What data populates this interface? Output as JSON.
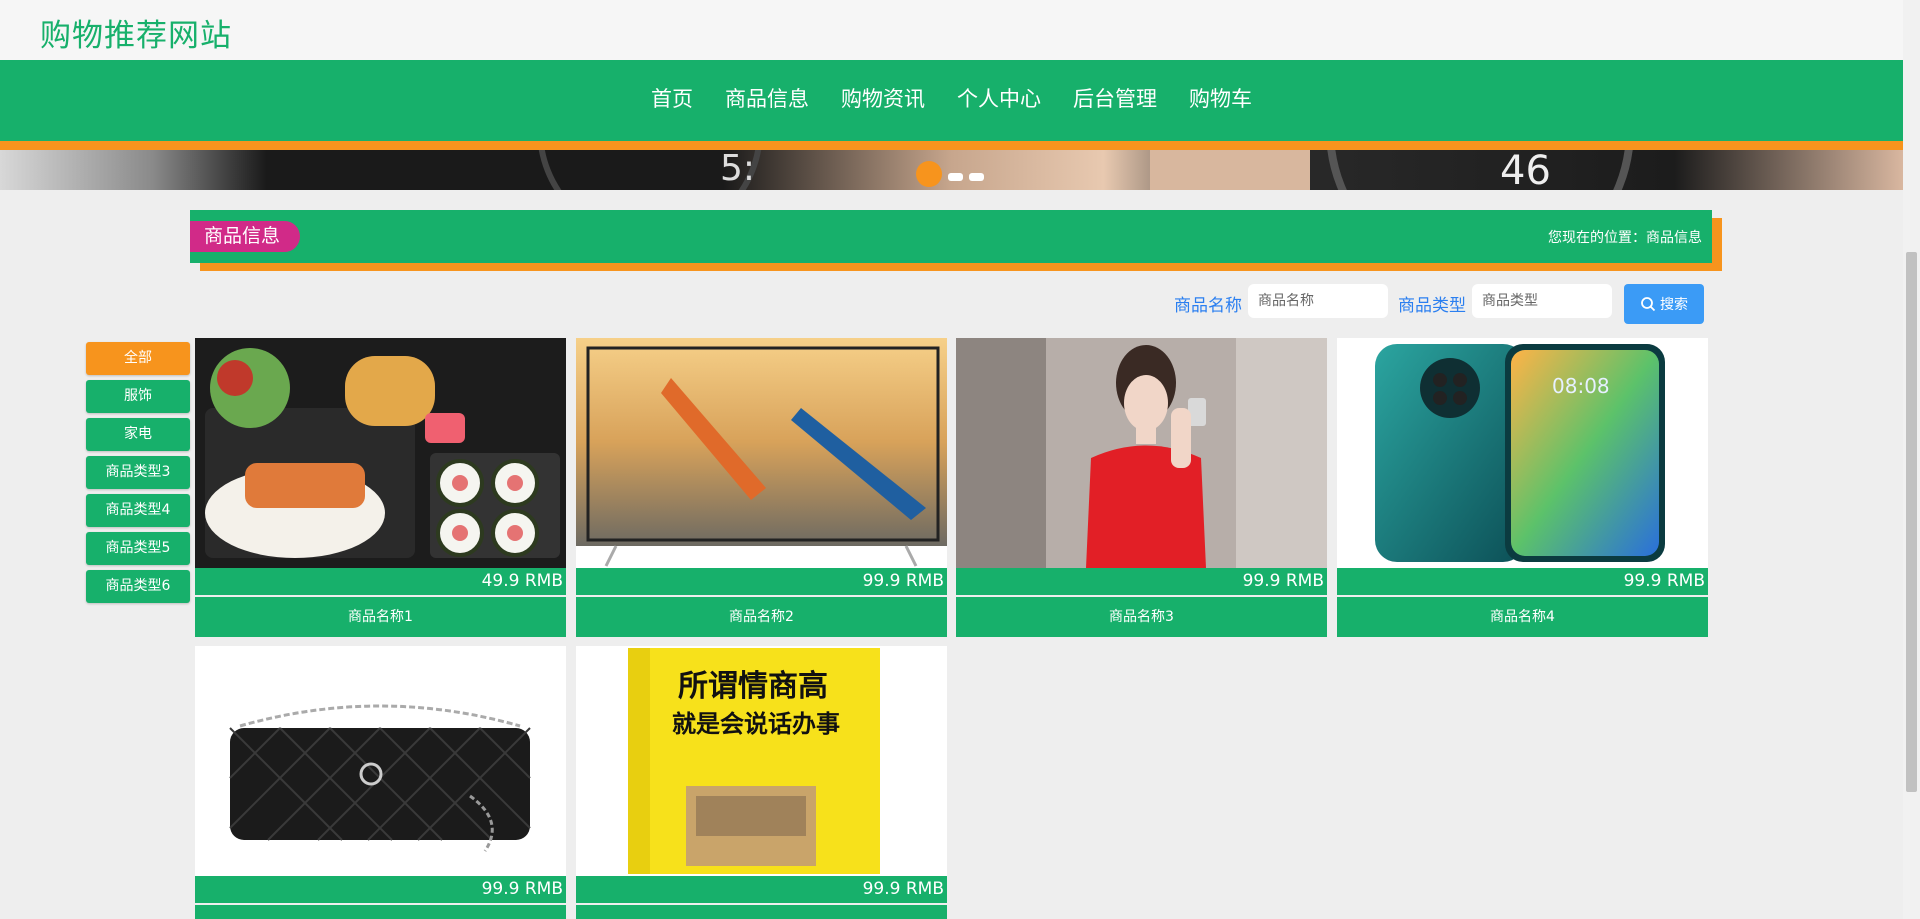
{
  "site": {
    "title": "购物推荐网站"
  },
  "nav": {
    "items": [
      "首页",
      "商品信息",
      "购物资讯",
      "个人中心",
      "后台管理",
      "购物车"
    ]
  },
  "section": {
    "tag": "商品信息",
    "breadcrumb": "您现在的位置：商品信息"
  },
  "search": {
    "name_label": "商品名称",
    "name_placeholder": "商品名称",
    "type_label": "商品类型",
    "type_placeholder": "商品类型",
    "button_label": "搜索"
  },
  "categories": [
    "全部",
    "服饰",
    "家电",
    "商品类型3",
    "商品类型4",
    "商品类型5",
    "商品类型6"
  ],
  "products": [
    {
      "name": "商品名称1",
      "price": "49.9 RMB",
      "image": "bento-food"
    },
    {
      "name": "商品名称2",
      "price": "99.9 RMB",
      "image": "tv-kayak"
    },
    {
      "name": "商品名称3",
      "price": "99.9 RMB",
      "image": "woman-red-top"
    },
    {
      "name": "商品名称4",
      "price": "99.9 RMB",
      "image": "smartphone"
    },
    {
      "name": "",
      "price": "99.9 RMB",
      "image": "black-handbag"
    },
    {
      "name": "",
      "price": "99.9 RMB",
      "image": "yellow-book",
      "book_title_1": "所谓情商高",
      "book_title_2": "就是会说话办事"
    }
  ],
  "colors": {
    "green": "#17b06b",
    "orange": "#f7941d",
    "magenta": "#d12a88",
    "blue": "#3b9bf6"
  }
}
